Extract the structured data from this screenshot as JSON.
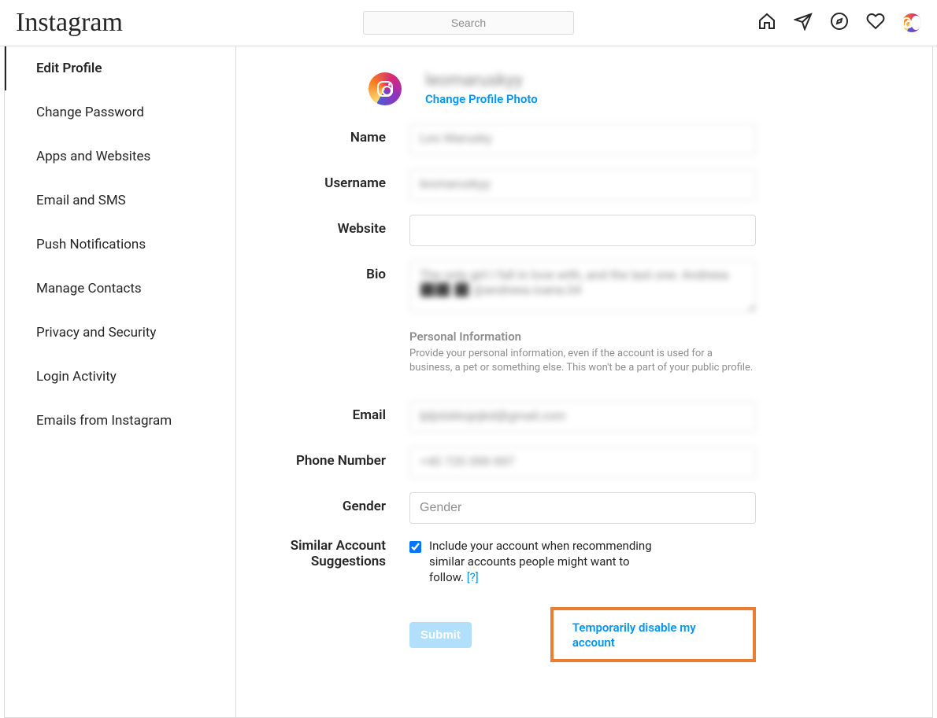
{
  "brand": "Instagram",
  "search": {
    "placeholder": "Search"
  },
  "sidebar": {
    "items": [
      {
        "label": "Edit Profile",
        "active": true
      },
      {
        "label": "Change Password",
        "active": false
      },
      {
        "label": "Apps and Websites",
        "active": false
      },
      {
        "label": "Email and SMS",
        "active": false
      },
      {
        "label": "Push Notifications",
        "active": false
      },
      {
        "label": "Manage Contacts",
        "active": false
      },
      {
        "label": "Privacy and Security",
        "active": false
      },
      {
        "label": "Login Activity",
        "active": false
      },
      {
        "label": "Emails from Instagram",
        "active": false
      }
    ]
  },
  "profile": {
    "username_display": "leomaruskyy",
    "change_photo": "Change Profile Photo"
  },
  "form": {
    "name": {
      "label": "Name",
      "value": "Leo Marusky"
    },
    "username": {
      "label": "Username",
      "value": "leomaruskyy"
    },
    "website": {
      "label": "Website",
      "value": ""
    },
    "bio": {
      "label": "Bio",
      "value": "The only girl I fall in love with, and the last one: Andreea ⬛⬛ ⬛ @andreea.ioana.04"
    },
    "personal_info": {
      "title": "Personal Information",
      "desc": "Provide your personal information, even if the account is used for a business, a pet or something else. This won't be a part of your public profile."
    },
    "email": {
      "label": "Email",
      "value": "ljdjslskksjejkd@gmail.com"
    },
    "phone": {
      "label": "Phone Number",
      "value": "+40 720 099 697"
    },
    "gender": {
      "label": "Gender",
      "placeholder": "Gender",
      "value": ""
    },
    "similar": {
      "label": "Similar Account Suggestions",
      "checkbox_label": "Include your account when recommending similar accounts people might want to follow.",
      "help": "[?]",
      "checked": true
    },
    "submit": "Submit",
    "disable": "Temporarily disable my account"
  }
}
